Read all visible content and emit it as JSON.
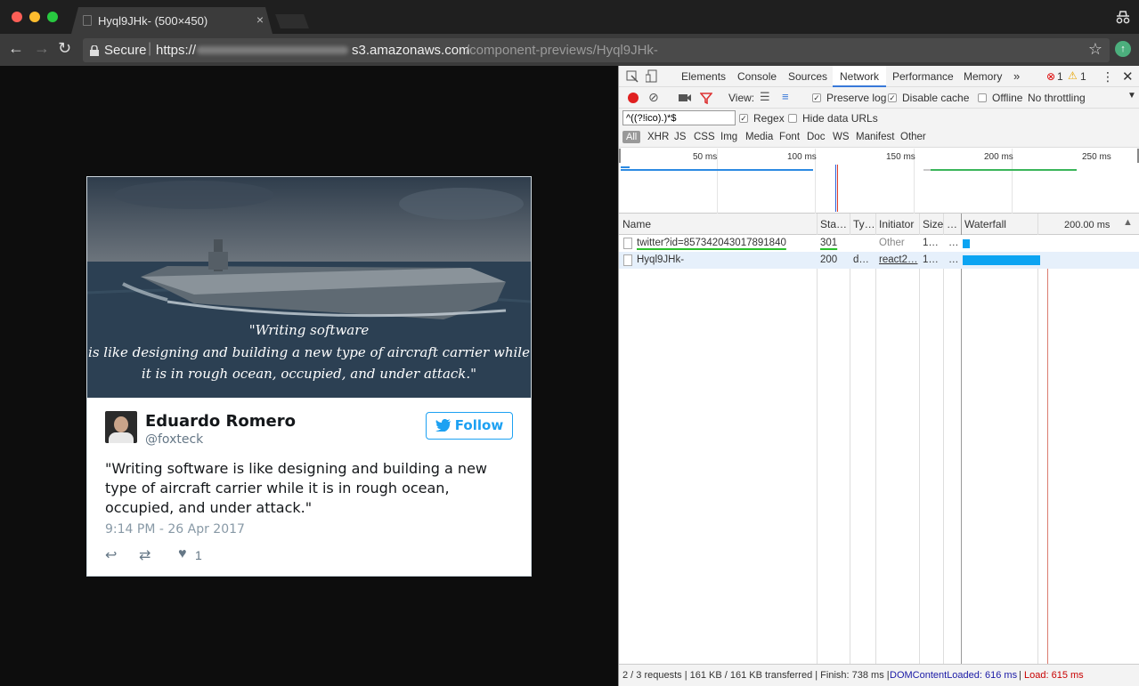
{
  "browser": {
    "tab_title": "Hyql9JHk- (500×450)",
    "tab_close": "×",
    "secure_label": "Secure",
    "url_scheme": "https://",
    "url_host": "s3.amazonaws.com",
    "url_path": "/component-previews/Hyql9JHk-"
  },
  "tweet": {
    "image_quote_l1": "\"Writing software",
    "image_quote_l2": "is like designing and building a new type of aircraft carrier while",
    "image_quote_l3": "it is in rough ocean, occupied, and under attack.\"",
    "name": "Eduardo Romero",
    "handle": "@foxteck",
    "follow_label": "Follow",
    "text": "\"Writing software is like designing and building a new type of aircraft carrier while it is in rough ocean, occupied, and under attack.\"",
    "timestamp": "9:14 PM - 26 Apr 2017",
    "likes": "1"
  },
  "devtools": {
    "tabs": [
      "Elements",
      "Console",
      "Sources",
      "Network",
      "Performance",
      "Memory",
      "»"
    ],
    "active_tab": "Network",
    "errors": "1",
    "warnings": "1",
    "view_label": "View:",
    "preserve_log": "Preserve log",
    "disable_cache": "Disable cache",
    "offline": "Offline",
    "throttling": "No throttling",
    "filter_value": "^((?!ico).)*$",
    "regex": "Regex",
    "hide_data_urls": "Hide data URLs",
    "types": [
      "All",
      "XHR",
      "JS",
      "CSS",
      "Img",
      "Media",
      "Font",
      "Doc",
      "WS",
      "Manifest",
      "Other"
    ],
    "timeline_ticks": [
      "50 ms",
      "100 ms",
      "150 ms",
      "200 ms",
      "250 ms"
    ],
    "columns": {
      "name": "Name",
      "status": "Sta…",
      "type": "Ty…",
      "initiator": "Initiator",
      "size": "Size",
      "time": "…",
      "waterfall": "Waterfall",
      "waterfall_time": "200.00 ms"
    },
    "rows": [
      {
        "name": "twitter?id=857342043017891840",
        "status": "301",
        "type": "",
        "initiator": "Other",
        "size": "1…",
        "time": "…"
      },
      {
        "name": "Hyql9JHk-",
        "status": "200",
        "type": "d…",
        "initiator": "react2…",
        "size": "1…",
        "time": "…"
      }
    ],
    "footer": {
      "summary": "2 / 3 requests | 161 KB / 161 KB transferred | Finish: 738 ms |",
      "dcl": "DOMContentLoaded: 616 ms",
      "sep": "|",
      "load": "Load: 615 ms"
    }
  },
  "colors": {
    "accent": "#1da1f2",
    "dcl": "#1a1aa6",
    "load": "#c80000",
    "request_bar": "#0ca4f2"
  }
}
